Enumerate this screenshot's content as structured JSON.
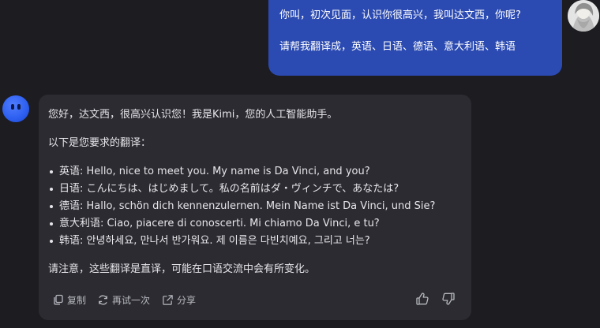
{
  "user_message": {
    "lines": [
      "你叫，初次见面，认识你很高兴，我叫达文西，你呢?",
      "请帮我翻译成，英语、日语、德语、意大利语、韩语"
    ]
  },
  "assistant_message": {
    "greeting": "您好，达文西，很高兴认识您！我是Kimi，您的人工智能助手。",
    "intro": "以下是您要求的翻译：",
    "translations": [
      {
        "text": "英语: Hello, nice to meet you. My name is Da Vinci, and you?"
      },
      {
        "text": "日语: こんにちは、はじめまして。私の名前はダ・ヴィンチで、あなたは?"
      },
      {
        "text": "德语: Hallo, schön dich kennenzulernen. Mein Name ist Da Vinci, und Sie?"
      },
      {
        "text": "意大利语: Ciao, piacere di conoscerti. Mi chiamo Da Vinci, e tu?"
      },
      {
        "text": "韩语: 안녕하세요, 만나서 반가워요. 제 이름은 다빈치예요, 그리고 너는?"
      }
    ],
    "note": "请注意，这些翻译是直译，可能在口语交流中会有所变化。"
  },
  "actions": {
    "copy_label": "复制",
    "retry_label": "再试一次",
    "share_label": "分享"
  },
  "colors": {
    "background": "#1c1c21",
    "user_bubble": "#2c4bb2",
    "assistant_bubble": "#2b2b31",
    "text": "#e6e6ea",
    "muted": "#b8b8c0"
  }
}
